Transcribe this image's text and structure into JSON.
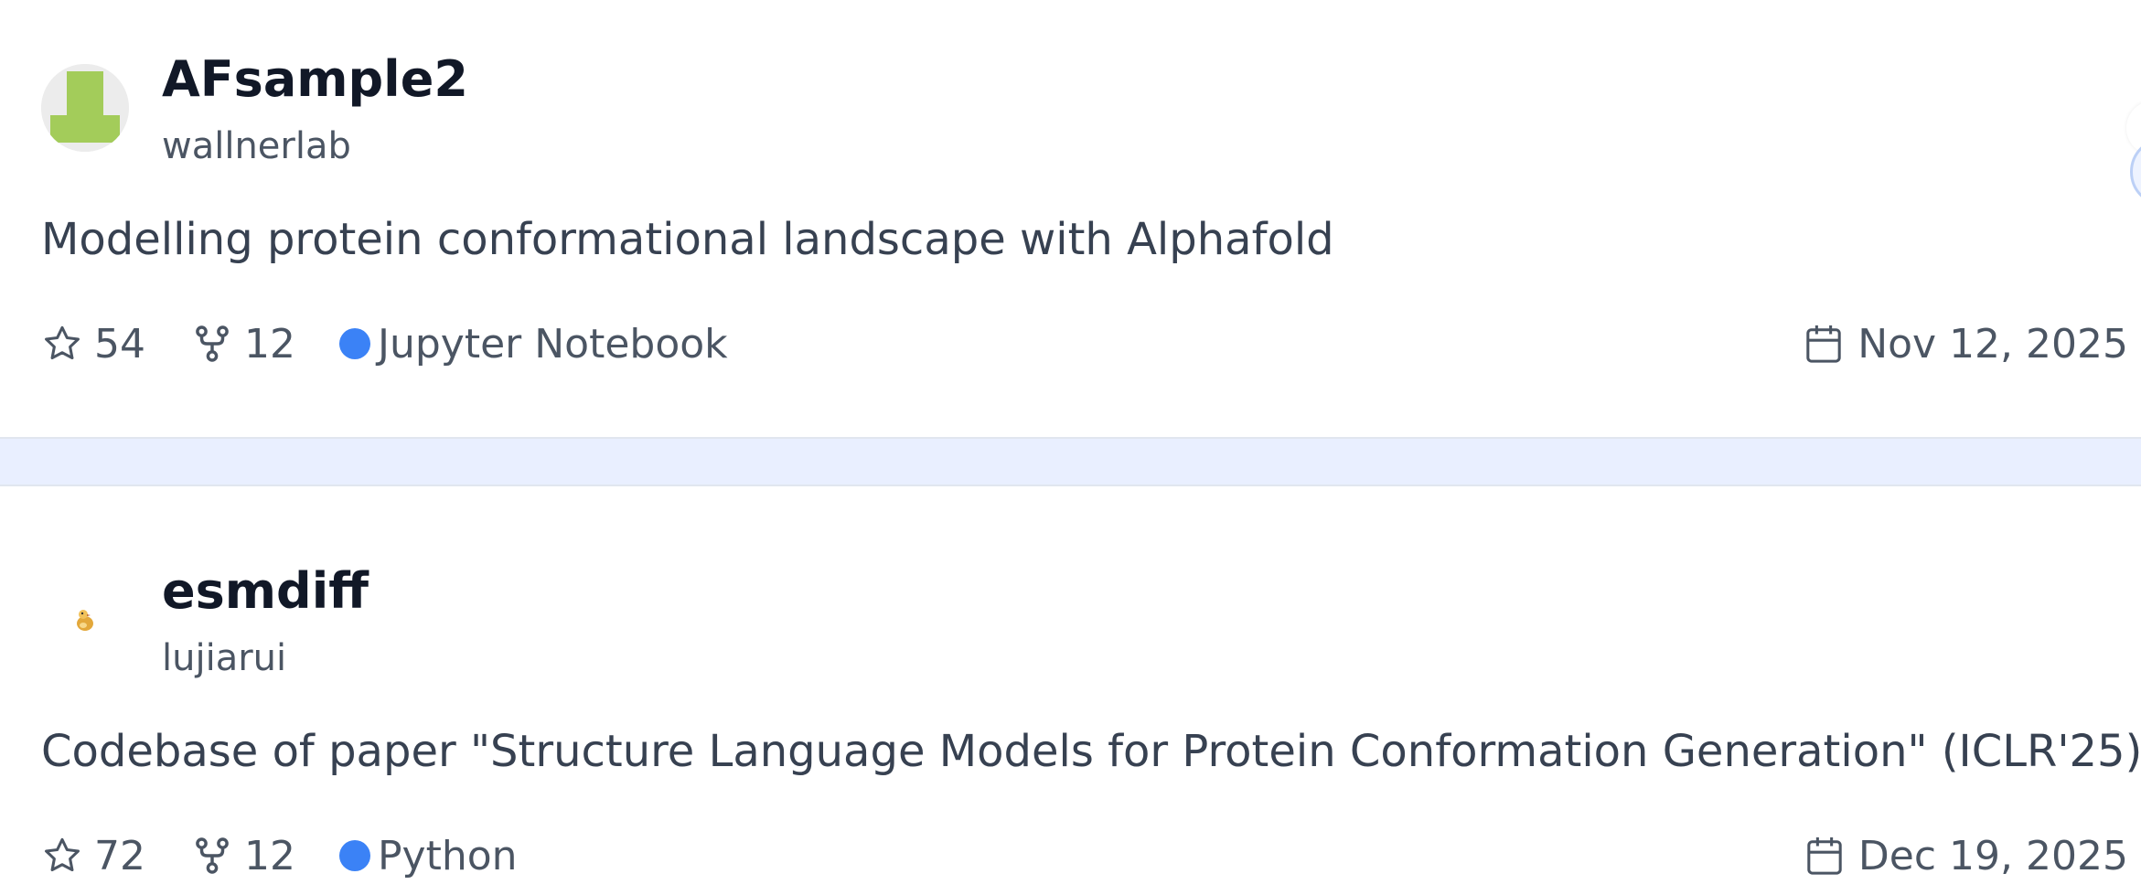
{
  "repos": [
    {
      "name": "AFsample2",
      "owner": "wallnerlab",
      "description": "Modelling protein conformational landscape with Alphafold",
      "stars": "54",
      "forks": "12",
      "language": "Jupyter Notebook",
      "language_color": "#3b82f6",
      "date": "Nov 12, 2025",
      "avatar_icon": "green-block-avatar-icon",
      "avatar_color": "#a3cc5a"
    },
    {
      "name": "esmdiff",
      "owner": "lujiarui",
      "description": "Codebase of paper \"Structure Language Models for Protein Conformation Generation\" (ICLR'25)",
      "stars": "72",
      "forks": "12",
      "language": "Python",
      "language_color": "#3b82f6",
      "date": "Dec 19, 2025",
      "avatar_icon": "duck-avatar-icon"
    }
  ],
  "icons": {
    "star": "star-icon",
    "fork": "fork-icon",
    "calendar": "calendar-icon"
  },
  "colors": {
    "separator_bg": "#e9efff",
    "text_primary": "#111827",
    "text_secondary": "#4b5563",
    "icon_gray": "#6b7280"
  }
}
